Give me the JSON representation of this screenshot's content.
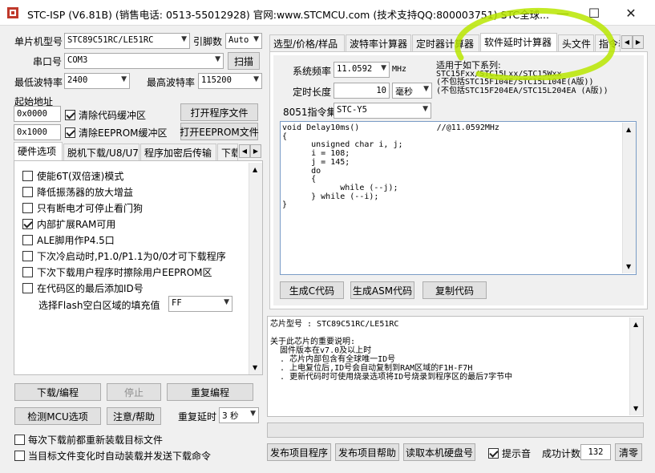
{
  "window": {
    "title": "STC-ISP (V6.81B) (销售电话: 0513-55012928) 官网:www.STCMCU.com  (技术支持QQ:800003751)  STC全球...",
    "minimize_glyph": "—",
    "maximize_glyph": "☐",
    "close_glyph": "✕"
  },
  "left": {
    "mcu_label": "单片机型号",
    "mcu_value": "STC89C51RC/LE51RC",
    "pin_label": "引脚数",
    "pin_value": "Auto",
    "port_label": "串口号",
    "port_value": "COM3",
    "scan_button": "扫描",
    "min_baud_label": "最低波特率",
    "min_baud_value": "2400",
    "max_baud_label": "最高波特率",
    "max_baud_value": "115200",
    "start_addr_label": "起始地址",
    "addr1": "0x0000",
    "clear_code_label": "清除代码缓冲区",
    "open_program_button": "打开程序文件",
    "addr2": "0x1000",
    "clear_eeprom_label": "清除EEPROM缓冲区",
    "open_eeprom_button": "打开EEPROM文件",
    "tabs": [
      "硬件选项",
      "脱机下载/U8/U7",
      "程序加密后传输",
      "下载"
    ],
    "options": [
      {
        "label": "使能6T(双倍速)模式",
        "checked": false
      },
      {
        "label": "降低振荡器的放大增益",
        "checked": false
      },
      {
        "label": "只有断电才可停止看门狗",
        "checked": false
      },
      {
        "label": "内部扩展RAM可用",
        "checked": true
      },
      {
        "label": "ALE脚用作P4.5口",
        "checked": false
      },
      {
        "label": "下次冷启动时,P1.0/P1.1为0/0才可下载程序",
        "checked": false
      },
      {
        "label": "下次下载用户程序时擦除用户EEPROM区",
        "checked": false
      },
      {
        "label": "在代码区的最后添加ID号",
        "checked": false
      }
    ],
    "flash_fill_label": "选择Flash空白区域的填充值",
    "flash_fill_value": "FF",
    "download_button": "下载/编程",
    "stop_button": "停止",
    "reprogram_button": "重复编程",
    "detect_button": "检测MCU选项",
    "help_button": "注意/帮助",
    "repeat_delay_label": "重复延时",
    "repeat_delay_value": "3 秒",
    "reload_label": "每次下载前都重新装载目标文件",
    "auto_send_label": "当目标文件变化时自动装载并发送下载命令"
  },
  "right": {
    "tabs": [
      "选型/价格/样品",
      "波特率计算器",
      "定时器计算器",
      "软件延时计算器",
      "头文件",
      "指令表"
    ],
    "active_tab": 3,
    "freq_label": "系统频率",
    "freq_value": "11.0592",
    "freq_unit": "MHz",
    "delay_label": "定时长度",
    "delay_value": "10",
    "delay_unit": "毫秒",
    "instr_label": "8051指令集",
    "instr_value": "STC-Y5",
    "applies_line1": "适用于如下系列:",
    "applies_line2": "STC15Fxx/STC15Lxx/STC15Wxx",
    "applies_line3": "(不包括STC15F104E/STC15L104E(A版))",
    "applies_line4": "(不包括STC15F204EA/STC15L204EA (A版))",
    "code_lines": [
      "void Delay10ms()\t\t//@11.0592MHz",
      "{",
      "\tunsigned char i, j;",
      "",
      "\ti = 108;",
      "\tj = 145;",
      "\tdo",
      "\t{",
      "\t\twhile (--j);",
      "\t} while (--i);",
      "}"
    ],
    "gen_c_button": "生成C代码",
    "gen_asm_button": "生成ASM代码",
    "copy_button": "复制代码",
    "info_lines": [
      "芯片型号 : STC89C51RC/LE51RC",
      "",
      "关于此芯片的重要说明:",
      "  固件版本在v7.0及以上时",
      "  . 芯片内部包含有全球唯一ID号",
      "  . 上电复位后,ID号会自动复制到RAM区域的F1H-F7H",
      "  . 更新代码时可使用烧录选项将ID号烧录到程序区的最后7字节中"
    ],
    "publish_button": "发布项目程序",
    "publish_help_button": "发布项目帮助",
    "read_disk_button": "读取本机硬盘号",
    "prompt_sound_label": "提示音",
    "success_count_label": "成功计数",
    "success_count_value": "132",
    "clear_button": "清零"
  }
}
